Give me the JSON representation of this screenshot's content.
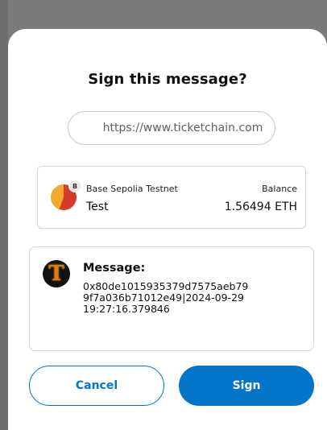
{
  "dialog": {
    "title": "Sign this message?",
    "origin": "https://www.ticketchain.com"
  },
  "account": {
    "network_badge": "B",
    "network_name": "Base Sepolia Testnet",
    "account_name": "Test",
    "balance_label": "Balance",
    "balance_value": "1.56494 ETH"
  },
  "message": {
    "logo_letter": "T",
    "label": "Message:",
    "lines": [
      "0x80de1015935379d7575aeb79",
      "9f7a036b71012e49|2024-09-29",
      "19:27:16.379846"
    ]
  },
  "actions": {
    "cancel_label": "Cancel",
    "sign_label": "Sign"
  },
  "colors": {
    "primary": "#0376c9",
    "backdrop": "#7b7b7b"
  }
}
